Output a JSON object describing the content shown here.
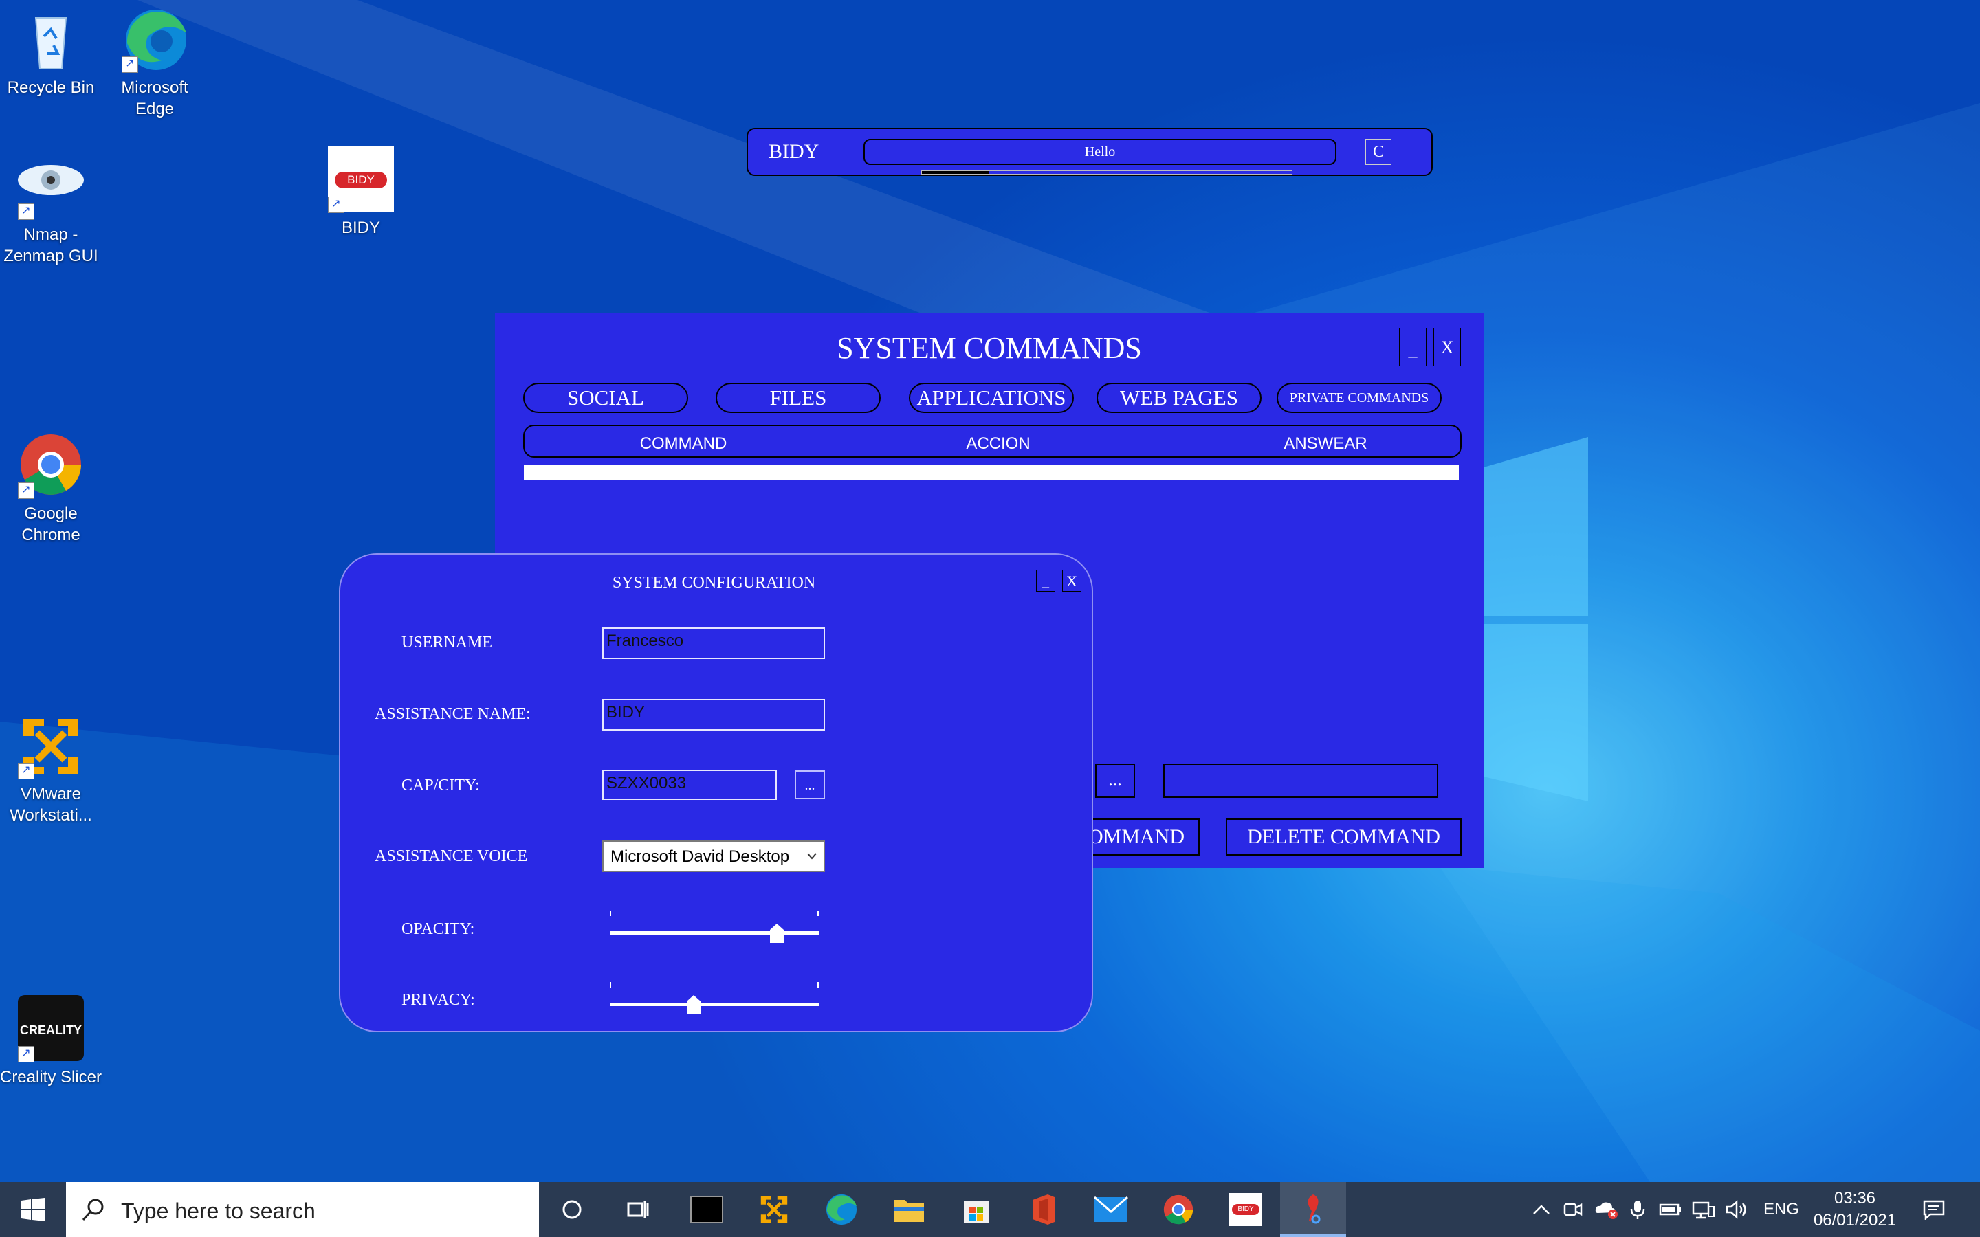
{
  "desktop": {
    "icons": [
      {
        "label": "Recycle Bin"
      },
      {
        "label": "Microsoft\nEdge"
      },
      {
        "label": "Nmap -\nZenmap GUI"
      },
      {
        "label": "BIDY"
      },
      {
        "label": "Google\nChrome"
      },
      {
        "label": "VMware\nWorkstati..."
      },
      {
        "label": "Creality Slicer"
      }
    ],
    "bidy_logo_text": "BIDY",
    "creality_logo_text": "CREALITY"
  },
  "bidy_bar": {
    "title": "BIDY",
    "message": "Hello",
    "button": "C",
    "progress": 0.18
  },
  "system_commands": {
    "title": "SYSTEM COMMANDS",
    "minimize": "_",
    "close": "X",
    "tabs": [
      "SOCIAL",
      "FILES",
      "APPLICATIONS",
      "WEB PAGES",
      "PRIVATE COMMANDS"
    ],
    "columns": [
      "COMMAND",
      "ACCION",
      "ANSWEAR"
    ],
    "browse_button": "...",
    "add_button_partial": "OMMAND",
    "delete_button": "DELETE COMMAND"
  },
  "system_configuration": {
    "title": "SYSTEM CONFIGURATION",
    "minimize": "_",
    "close": "X",
    "username_label": "USERNAME",
    "username_value": "Francesco",
    "assistance_name_label": "ASSISTANCE NAME:",
    "assistance_name_value": "BIDY",
    "cap_city_label": "CAP/CITY:",
    "cap_city_value": "SZXX0033",
    "cap_city_browse": "...",
    "voice_label": "ASSISTANCE VOICE",
    "voice_value": "Microsoft David Desktop",
    "opacity_label": "OPACITY:",
    "opacity_value": 0.8,
    "privacy_label": "PRIVACY:",
    "privacy_value": 0.4
  },
  "taskbar": {
    "search_placeholder": "Type here to search",
    "language": "ENG",
    "time": "03:36",
    "date": "06/01/2021",
    "bidy_app_text": "BIDY"
  }
}
